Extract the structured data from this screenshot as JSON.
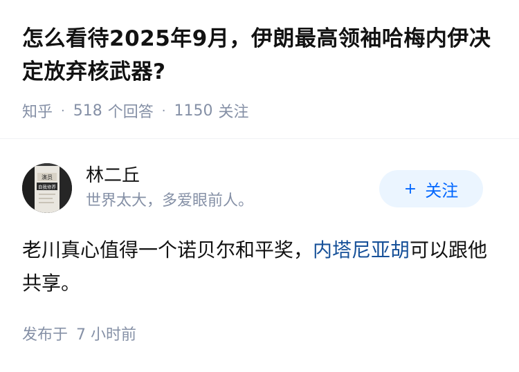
{
  "question": {
    "title": "怎么看待2025年9月，伊朗最高领袖哈梅内伊决定放弃核武器?"
  },
  "meta": {
    "source": "知乎",
    "separator": "·",
    "answers_count": "518",
    "answers_label": "个回答",
    "follows_count": "1150",
    "follows_label": "关注"
  },
  "author": {
    "name": "林二丘",
    "bio": "世界太大，多爱眼前人。",
    "avatar_text_line1": "演员",
    "avatar_text_line2": "自我修养"
  },
  "follow_button": {
    "icon": "+",
    "label": "关注"
  },
  "answer": {
    "text_before": "老川真心值得一个诺贝尔和平奖，",
    "link_text": "内塔尼亚胡",
    "text_after": "可以跟他共享。"
  },
  "post": {
    "label": "发布于",
    "time": "7 小时前"
  },
  "colors": {
    "accent": "#0066ff",
    "link": "#175199",
    "meta_gray": "#8590a6",
    "follow_bg": "#ebf5ff"
  }
}
